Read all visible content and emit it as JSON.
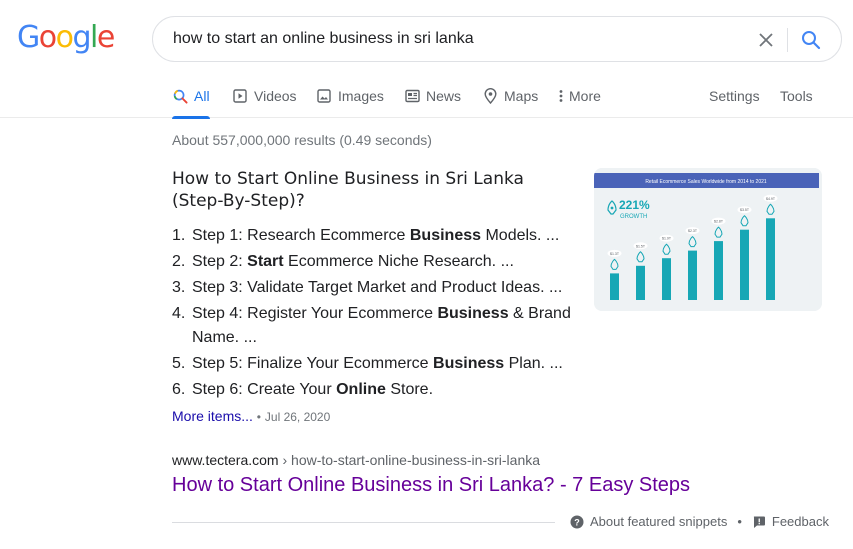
{
  "logo": {
    "letters": [
      "G",
      "o",
      "o",
      "g",
      "l",
      "e"
    ]
  },
  "search": {
    "query": "how to start an online business in sri lanka"
  },
  "tabs": [
    {
      "label": "All",
      "icon": "search-icon"
    },
    {
      "label": "Videos",
      "icon": "video-icon"
    },
    {
      "label": "Images",
      "icon": "image-icon"
    },
    {
      "label": "News",
      "icon": "news-icon"
    },
    {
      "label": "Maps",
      "icon": "map-pin-icon"
    },
    {
      "label": "More",
      "icon": "more-vert-icon"
    },
    {
      "label": "Settings"
    },
    {
      "label": "Tools"
    }
  ],
  "stats": "About 557,000,000 results (0.49 seconds)",
  "featured": {
    "title": "How to Start Online Business in Sri Lanka (Step-By-Step)?",
    "steps": [
      {
        "num": "1.",
        "parts": [
          {
            "t": "Step 1: Research Ecommerce ",
            "b": false
          },
          {
            "t": "Business",
            "b": true
          },
          {
            "t": " Models. ...",
            "b": false
          }
        ]
      },
      {
        "num": "2.",
        "parts": [
          {
            "t": "Step 2: ",
            "b": false
          },
          {
            "t": "Start",
            "b": true
          },
          {
            "t": " Ecommerce Niche Research. ...",
            "b": false
          }
        ]
      },
      {
        "num": "3.",
        "parts": [
          {
            "t": "Step 3: Validate Target Market and Product Ideas. ...",
            "b": false
          }
        ]
      },
      {
        "num": "4.",
        "parts": [
          {
            "t": "Step 4: Register Your Ecommerce ",
            "b": false
          },
          {
            "t": "Business",
            "b": true
          },
          {
            "t": " & Brand Name. ...",
            "b": false
          }
        ]
      },
      {
        "num": "5.",
        "parts": [
          {
            "t": "Step 5: Finalize Your Ecommerce ",
            "b": false
          },
          {
            "t": "Business",
            "b": true
          },
          {
            "t": " Plan. ...",
            "b": false
          }
        ]
      },
      {
        "num": "6.",
        "parts": [
          {
            "t": "Step 6: Create Your ",
            "b": false
          },
          {
            "t": "Online",
            "b": true
          },
          {
            "t": " Store.",
            "b": false
          }
        ]
      }
    ],
    "more_items": "More items...",
    "separator": "•",
    "date": "Jul 26, 2020",
    "thumbnail": {
      "header": "Retail Ecommerce Sales Worldwide from 2014 to 2021",
      "growth_value": "221%",
      "growth_label": "GROWTH",
      "bar_levels": [
        0.28,
        0.36,
        0.44,
        0.52,
        0.62,
        0.74,
        0.86
      ],
      "bar_labels": [
        "$1.3T",
        "$1.5T",
        "$1.9T",
        "$2.3T",
        "$2.8T",
        "$3.5T",
        "$4.9T"
      ]
    }
  },
  "result": {
    "domain": "www.tectera.com",
    "breadcrumb": " › how-to-start-online-business-in-sri-lanka",
    "title": "How to Start Online Business in Sri Lanka? - 7 Easy Steps"
  },
  "footer": {
    "about": "About featured snippets",
    "dot": "•",
    "feedback": "Feedback"
  },
  "colors": {
    "blue": "#4285F4",
    "red": "#EA4335",
    "yellow": "#FBBC05",
    "green": "#34A853",
    "tab_active": "#1a73e8",
    "link": "#1a0dab",
    "visited": "#660099",
    "thumb_header": "#4a63b8",
    "bar": "#17a7b5"
  }
}
